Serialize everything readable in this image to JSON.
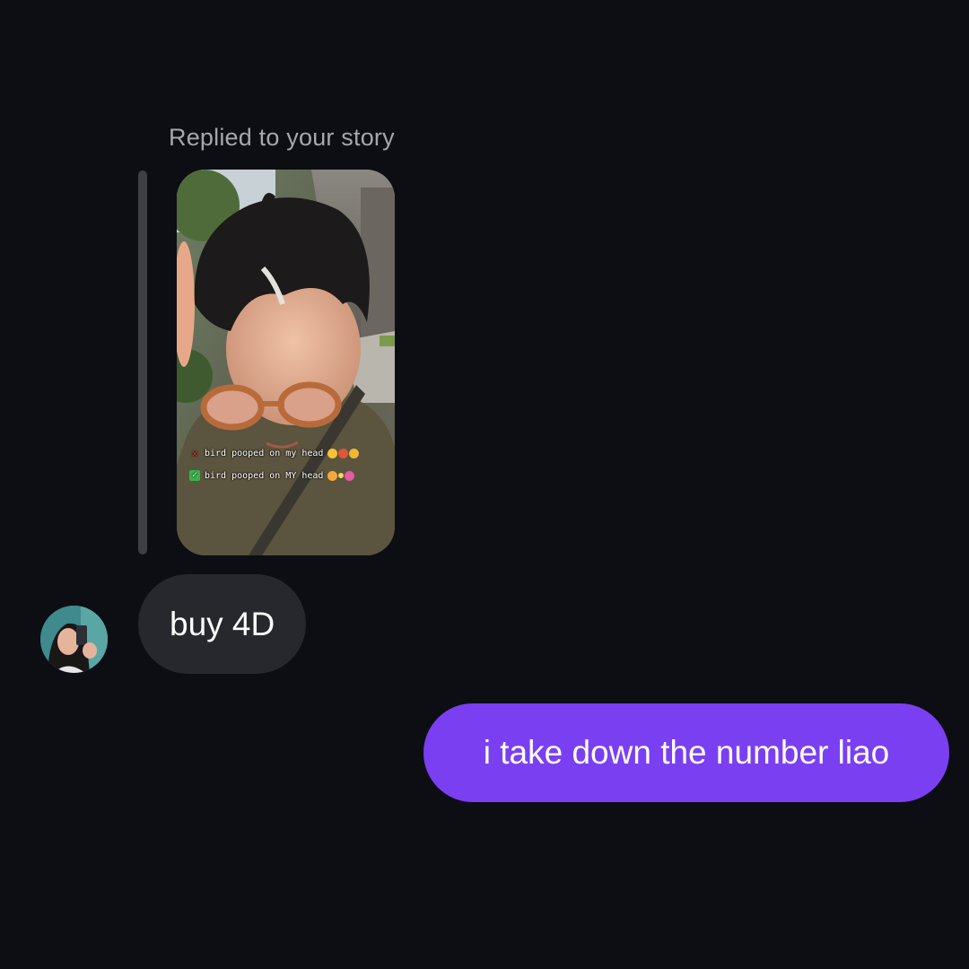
{
  "thread": {
    "reply_label": "Replied to your story",
    "story": {
      "caption_wrong": "bird pooped on my head",
      "caption_right": "bird pooped on MY head"
    },
    "messages": [
      {
        "sender": "other",
        "text": "buy 4D"
      },
      {
        "sender": "me",
        "text": "i take down the number liao"
      }
    ]
  },
  "colors": {
    "background": "#0c0e13",
    "incoming_bubble": "#26282d",
    "outgoing_bubble": "#7b3ff2",
    "meta_text": "#a4a7ad"
  },
  "icons": {
    "wrong_mark": "cross-mark-icon",
    "right_mark": "check-mark-icon"
  }
}
